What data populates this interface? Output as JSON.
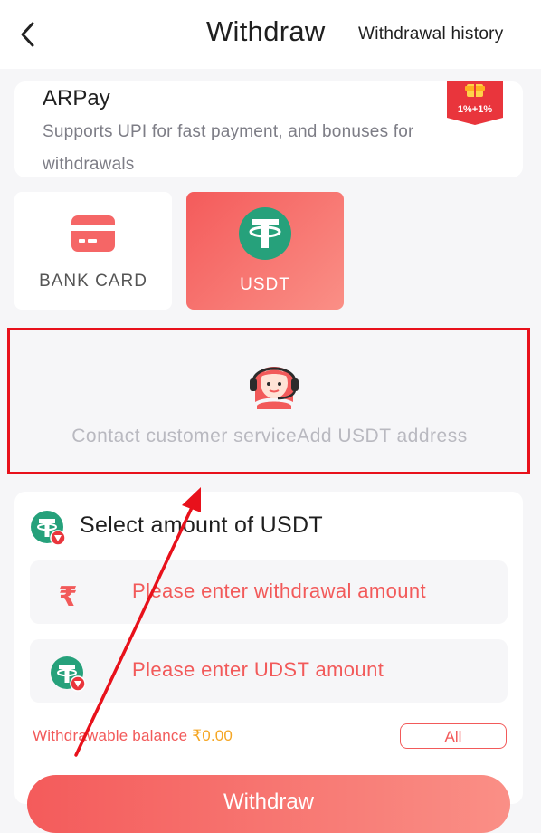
{
  "header": {
    "title": "Withdraw",
    "history_label": "Withdrawal history"
  },
  "arpay": {
    "title": "ARPay",
    "description": "Supports UPI for fast payment, and bonuses for withdrawals",
    "badge": "1%+1%"
  },
  "methods": [
    {
      "label": "BANK CARD",
      "icon": "bank-card-icon",
      "selected": false
    },
    {
      "label": "USDT",
      "icon": "usdt-icon",
      "selected": true
    }
  ],
  "contact": {
    "text": "Contact customer serviceAdd USDT address",
    "icon": "customer-service-icon"
  },
  "amount": {
    "title": "Select amount of USDT",
    "withdrawal_placeholder": "Please enter withdrawal amount",
    "usdt_placeholder": "Please enter UDST amount",
    "balance_label": "Withdrawable balance ",
    "balance_value": "₹0.00",
    "all_label": "All",
    "withdraw_label": "Withdraw"
  },
  "colors": {
    "accent": "#f25a5a",
    "usdt_green": "#26a17b",
    "balance_value": "#f5a623",
    "annotation_red": "#e8111b"
  }
}
